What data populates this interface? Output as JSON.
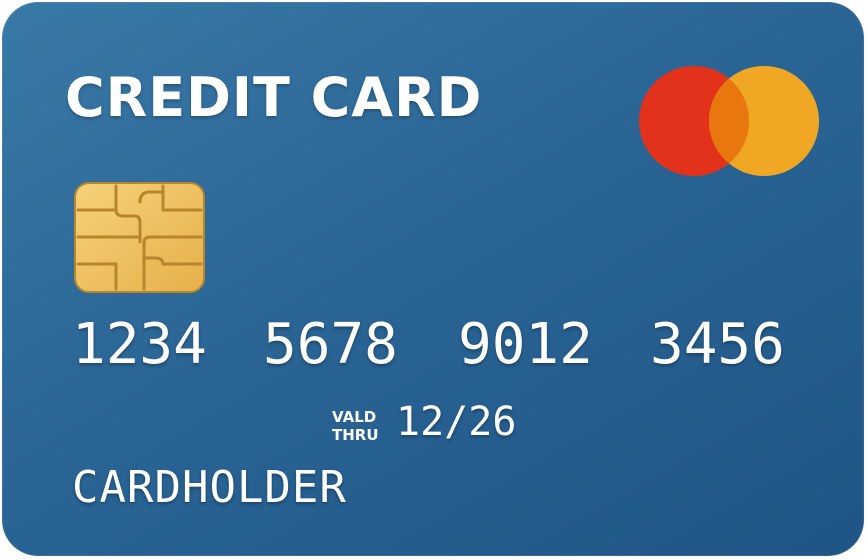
{
  "card": {
    "title": "CREDIT CARD",
    "number_groups": [
      "1234",
      "5678",
      "9012",
      "3456"
    ],
    "valid_thru_line1": "VALD",
    "valid_thru_line2": "THRU",
    "expiry": "12/26",
    "cardholder": "CARDHOLDER"
  },
  "logo": {
    "icon": "card-network-logo-icon",
    "left_circle_color": "#e2321c",
    "right_circle_color": "#f0a824",
    "overlap_color": "#e8770e"
  },
  "chip": {
    "icon": "emv-chip-icon",
    "color": "#f0c05a"
  },
  "colors": {
    "card_background": "#2a6595",
    "text": "#ffffff"
  }
}
